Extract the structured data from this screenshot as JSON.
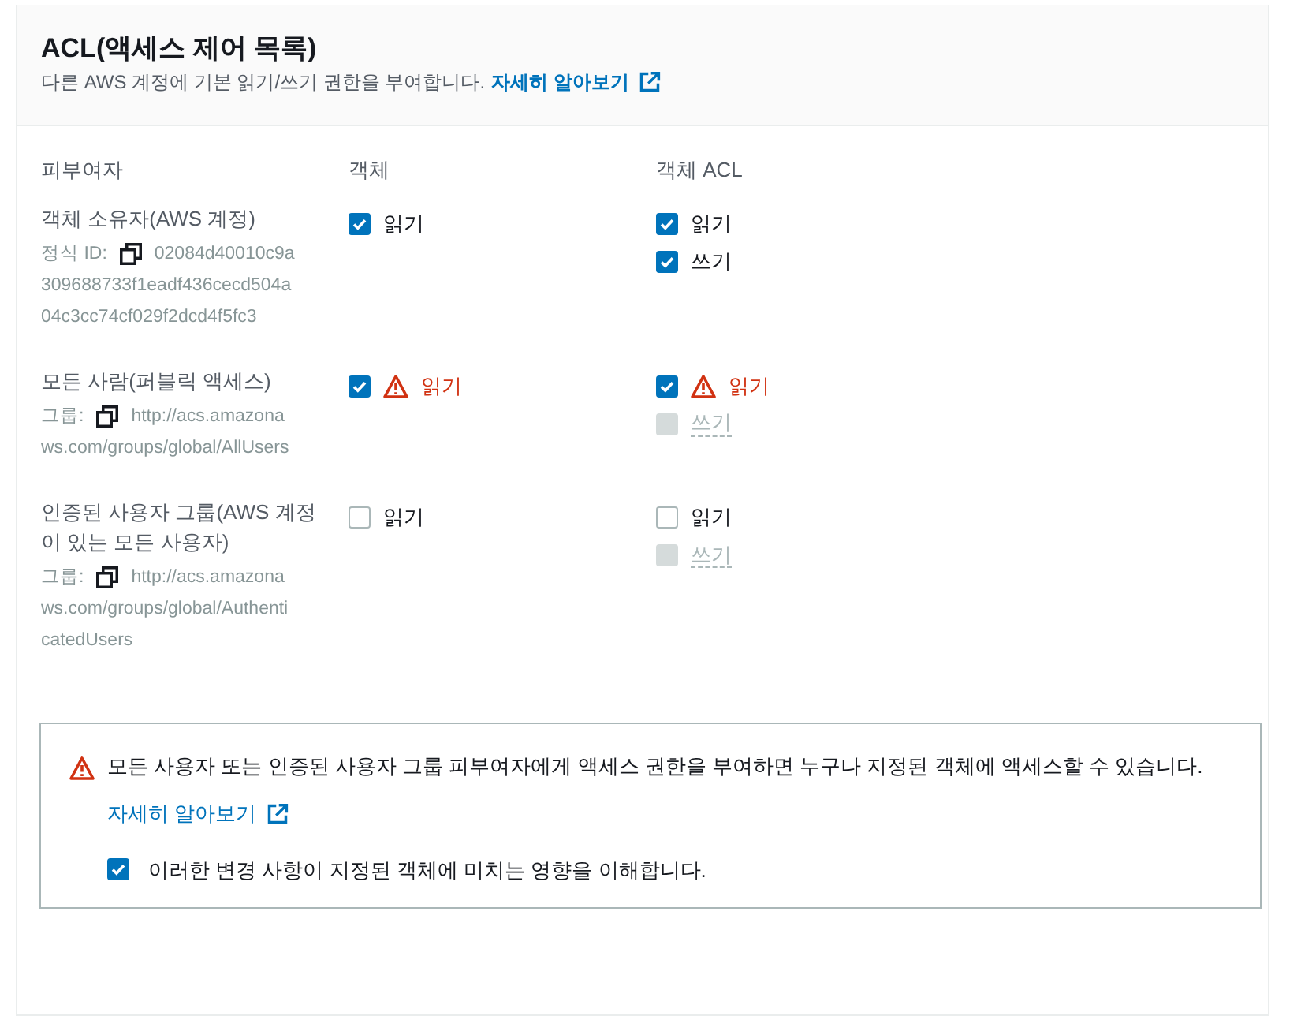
{
  "panel": {
    "title": "ACL(액세스 제어 목록)",
    "description": "다른 AWS 계정에 기본 읽기/쓰기 권한을 부여합니다.",
    "learn_more": "자세히 알아보기"
  },
  "columns": [
    "피부여자",
    "객체",
    "객체 ACL"
  ],
  "grantees": [
    {
      "name": "객체 소유자(AWS 계정)",
      "id_label": "정식 ID:",
      "id_value_lines": [
        "02084d40010c9a",
        "309688733f1eadf436cecd504a",
        "04c3cc74cf029f2dcd4f5fc3"
      ],
      "objects": [
        {
          "label": "읽기",
          "checked": true,
          "disabled": false,
          "warning": false
        }
      ],
      "object_acl": [
        {
          "label": "읽기",
          "checked": true,
          "disabled": false,
          "warning": false
        },
        {
          "label": "쓰기",
          "checked": true,
          "disabled": false,
          "warning": false
        }
      ]
    },
    {
      "name": "모든 사람(퍼블릭 액세스)",
      "id_label": "그룹:",
      "id_value_lines": [
        "http://acs.amazona",
        "ws.com/groups/global/AllUsers"
      ],
      "objects": [
        {
          "label": "읽기",
          "checked": true,
          "disabled": false,
          "warning": true
        }
      ],
      "object_acl": [
        {
          "label": "읽기",
          "checked": true,
          "disabled": false,
          "warning": true
        },
        {
          "label": "쓰기",
          "checked": false,
          "disabled": true,
          "warning": false
        }
      ]
    },
    {
      "name": "인증된 사용자 그룹(AWS 계정이 있는 모든 사용자)",
      "id_label": "그룹:",
      "id_value_lines": [
        "http://acs.amazona",
        "ws.com/groups/global/Authenti",
        "catedUsers"
      ],
      "objects": [
        {
          "label": "읽기",
          "checked": false,
          "disabled": false,
          "warning": false
        }
      ],
      "object_acl": [
        {
          "label": "읽기",
          "checked": false,
          "disabled": false,
          "warning": false
        },
        {
          "label": "쓰기",
          "checked": false,
          "disabled": true,
          "warning": false
        }
      ]
    }
  ],
  "alert": {
    "message": "모든 사용자 또는 인증된 사용자 그룹 피부여자에게 액세스 권한을 부여하면 누구나 지정된 객체에 액세스할 수 있습니다.",
    "learn_more": "자세히 알아보기",
    "acknowledge": {
      "label": "이러한 변경 사항이 지정된 객체에 미치는 영향을 이해합니다.",
      "checked": true
    }
  }
}
